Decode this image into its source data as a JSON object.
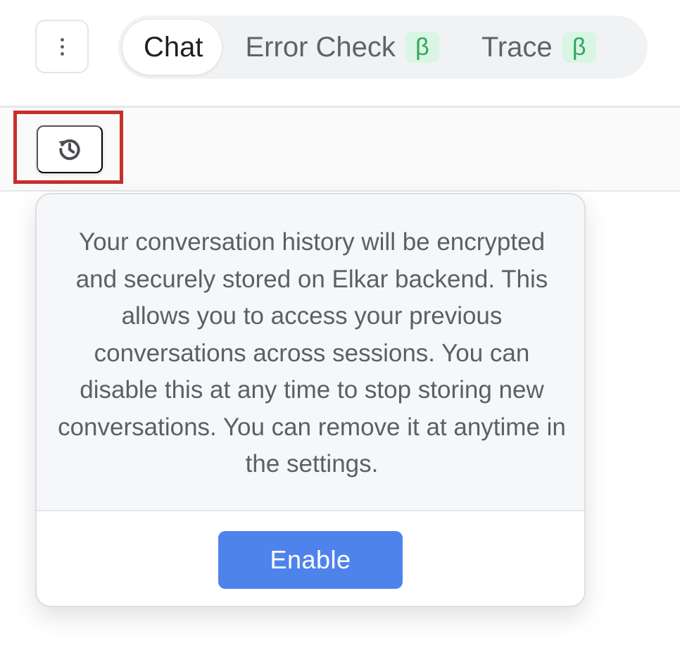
{
  "header": {
    "menu_icon": "vertical-ellipsis-icon",
    "tabs": [
      {
        "label": "Chat",
        "active": true,
        "badge": ""
      },
      {
        "label": "Error Check",
        "active": false,
        "badge": "β"
      },
      {
        "label": "Trace",
        "active": false,
        "badge": "β"
      }
    ]
  },
  "toolbar": {
    "history_icon": "history-icon"
  },
  "popover": {
    "message": "Your conversation history will be encrypted and securely stored on Elkar backend. This allows you to access your previous conversations across sessions. You can disable this at any time to stop storing new conversations. You can remove it at anytime in the settings.",
    "enable_label": "Enable"
  },
  "colors": {
    "accent": "#4f83ec",
    "beta_bg": "#d9f5e3",
    "beta_text": "#2fa85a",
    "highlight": "#c62f2a"
  }
}
